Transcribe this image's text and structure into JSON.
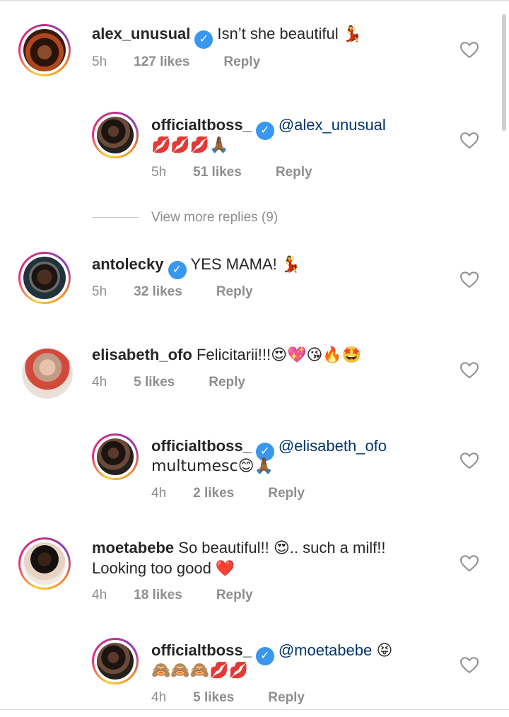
{
  "comments": [
    {
      "username": "alex_unusual",
      "verified": true,
      "text": "Isn’t she beautiful",
      "emoji": "💃",
      "time": "5h",
      "likes": "127 likes",
      "reply": "Reply"
    },
    {
      "username": "officialtboss_",
      "verified": true,
      "mention": "@alex_unusual",
      "text2": "💋💋💋🙏🏾",
      "time": "5h",
      "likes": "51 likes",
      "reply": "Reply"
    },
    {
      "username": "antolecky",
      "verified": true,
      "text": "YES MAMA!",
      "emoji": "💃",
      "time": "5h",
      "likes": "32 likes",
      "reply": "Reply"
    },
    {
      "username": "elisabeth_ofo",
      "verified": false,
      "text": "Felicitarii!!!",
      "emoji": "😍💖😘🔥🤩",
      "time": "4h",
      "likes": "5 likes",
      "reply": "Reply"
    },
    {
      "username": "officialtboss_",
      "verified": true,
      "mention": "@elisabeth_ofo",
      "text2": "multumesc😊🙏🏾",
      "time": "4h",
      "likes": "2 likes",
      "reply": "Reply"
    },
    {
      "username": "moetabebe",
      "verified": false,
      "text": "So beautiful!! 😍.. such a milf!!",
      "text2": "Looking too good ❤️",
      "time": "4h",
      "likes": "18 likes",
      "reply": "Reply"
    },
    {
      "username": "officialtboss_",
      "verified": true,
      "mention": "@moetabebe",
      "emoji": "😝",
      "text2": "🙈🙈🙈💋💋",
      "time": "4h",
      "likes": "5 likes",
      "reply": "Reply"
    }
  ],
  "view_more_replies": "View more replies (9)",
  "verified_glyph": "✓",
  "icons": {
    "like": "heart-outline-icon",
    "verified": "verified-badge-icon"
  },
  "colors": {
    "verified": "#3897f0",
    "mention": "#003569",
    "meta": "#8e8e8e",
    "text": "#262626"
  }
}
